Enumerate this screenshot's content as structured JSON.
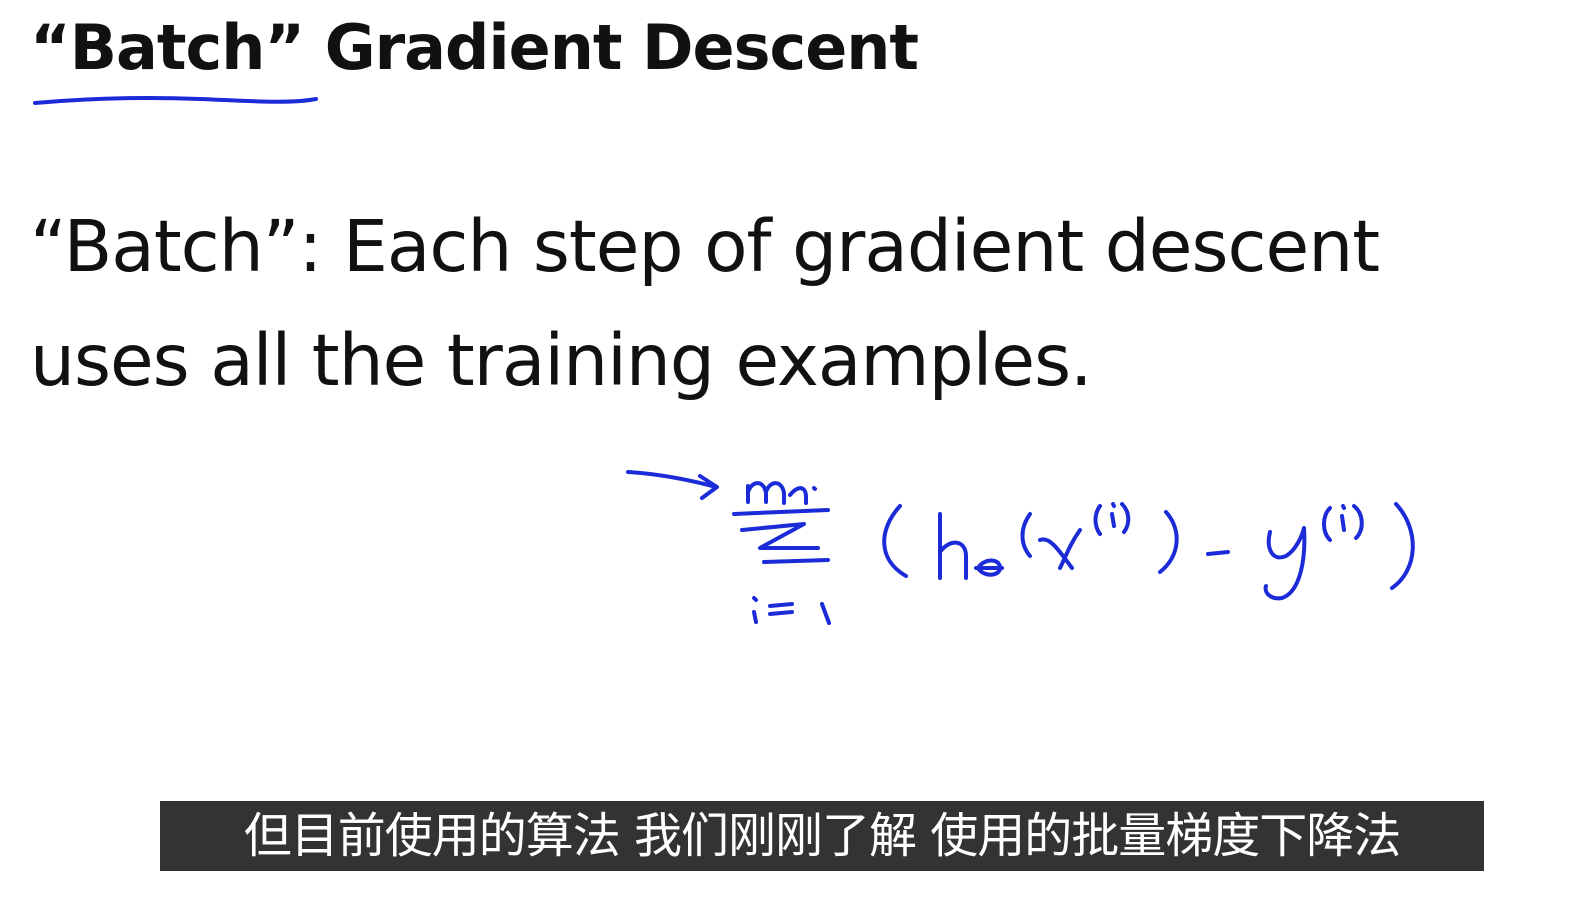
{
  "slide": {
    "title": "“Batch” Gradient Descent",
    "body_lines": [
      "“Batch”: Each step of gradient descent",
      "uses all the training examples."
    ]
  },
  "handwriting": {
    "ink_color": "#1b2bd8",
    "annotation": "sum from i=1 to m of (h_theta(x^(i)) - y^(i))"
  },
  "subtitle": {
    "text": "但目前使用的算法 我们刚刚了解 使用的批量梯度下降法"
  }
}
